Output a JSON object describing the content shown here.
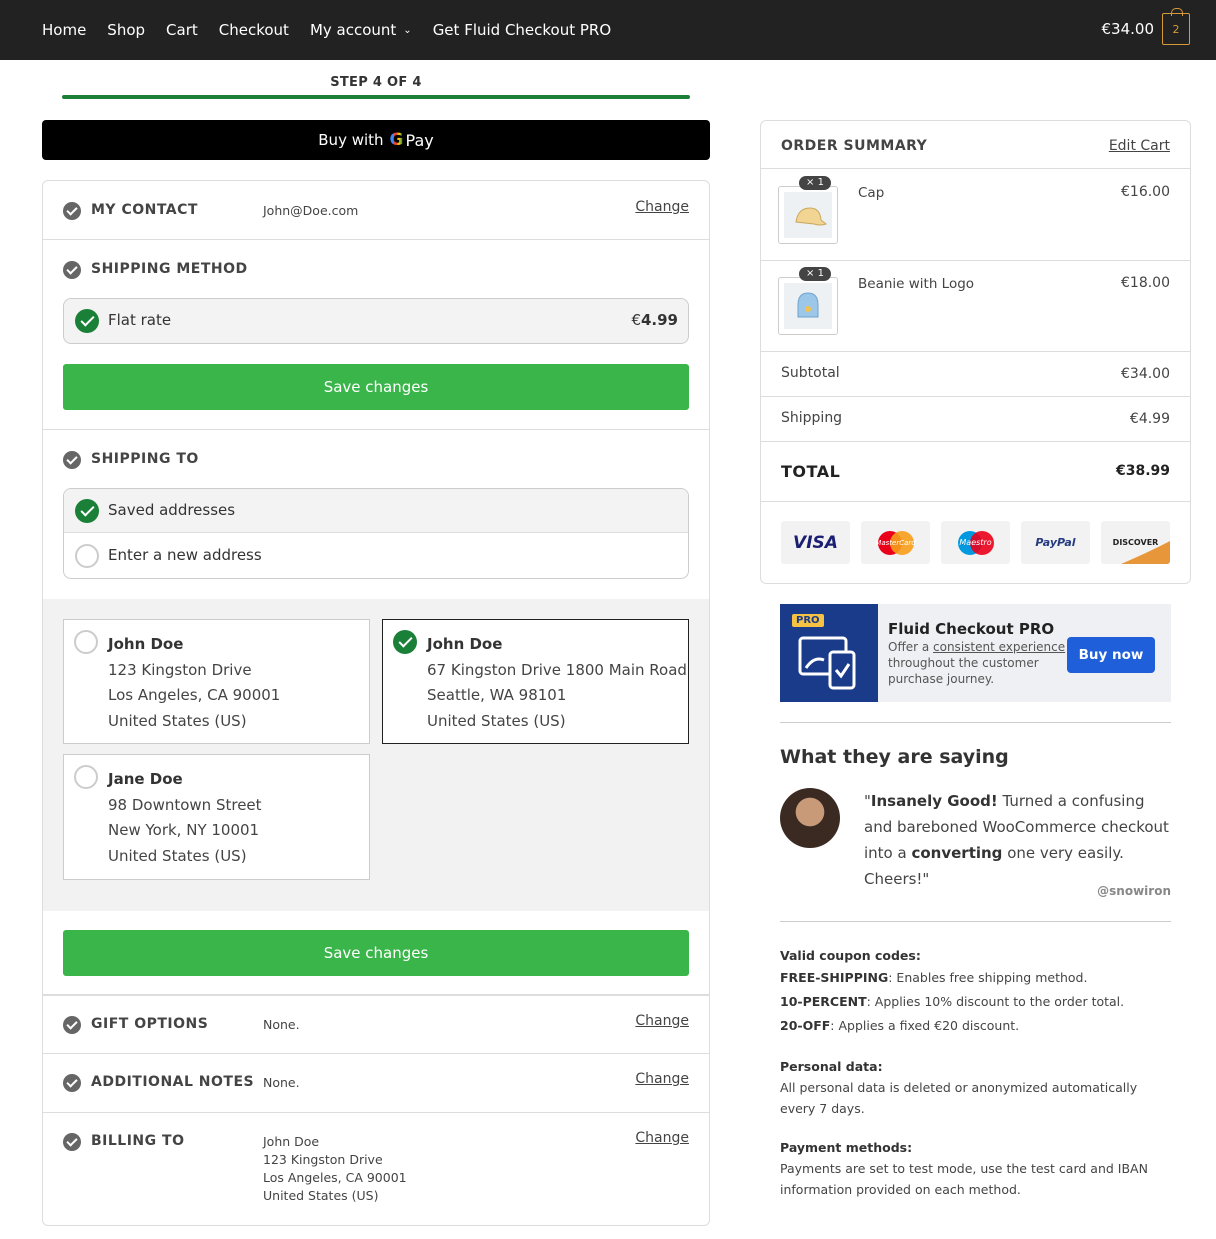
{
  "nav": {
    "items": [
      "Home",
      "Shop",
      "Cart",
      "Checkout",
      "My account",
      "Get Fluid Checkout PRO"
    ],
    "cart_total": "€34.00",
    "cart_count": "2"
  },
  "progress": {
    "label": "STEP 4 OF 4",
    "fraction": 1.0
  },
  "gpay": {
    "prefix": "Buy with",
    "g": "G",
    "pay": "Pay"
  },
  "contact": {
    "title": "MY CONTACT",
    "value": "John@Doe.com",
    "change": "Change"
  },
  "shipping_method": {
    "title": "SHIPPING METHOD",
    "option_label": "Flat rate",
    "option_price_symbol": "€",
    "option_price": "4.99",
    "save": "Save changes"
  },
  "shipping_to": {
    "title": "SHIPPING TO",
    "options": [
      "Saved addresses",
      "Enter a new address"
    ],
    "addresses": [
      {
        "name": "John Doe",
        "line1": "123 Kingston Drive",
        "line2": "Los Angeles, CA 90001",
        "country": "United States (US)"
      },
      {
        "name": "John Doe",
        "line1": "67 Kingston Drive 1800 Main Road",
        "line2": "Seattle, WA 98101",
        "country": "United States (US)"
      },
      {
        "name": "Jane Doe",
        "line1": "98 Downtown Street",
        "line2": "New York, NY 10001",
        "country": "United States (US)"
      }
    ],
    "save": "Save changes"
  },
  "gift": {
    "title": "GIFT OPTIONS",
    "value": "None.",
    "change": "Change"
  },
  "notes": {
    "title": "ADDITIONAL NOTES",
    "value": "None.",
    "change": "Change"
  },
  "billing": {
    "title": "BILLING TO",
    "lines": [
      "John Doe",
      "123 Kingston Drive",
      "Los Angeles, CA 90001",
      "United States (US)"
    ],
    "change": "Change"
  },
  "order_summary": {
    "title": "ORDER SUMMARY",
    "edit": "Edit Cart",
    "items": [
      {
        "qty": "× 1",
        "name": "Cap",
        "price": "€16.00"
      },
      {
        "qty": "× 1",
        "name": "Beanie with Logo",
        "price": "€18.00"
      }
    ],
    "subtotal_label": "Subtotal",
    "subtotal": "€34.00",
    "shipping_label": "Shipping",
    "shipping": "€4.99",
    "total_label": "TOTAL",
    "total": "€38.99",
    "payment_icons": [
      "VISA",
      "MasterCard",
      "Maestro",
      "PayPal",
      "DISCOVER"
    ]
  },
  "pro": {
    "tag": "PRO",
    "title": "Fluid Checkout PRO",
    "desc_pre": "Offer a ",
    "desc_link": "consistent experience",
    "desc_post": " throughout the customer purchase journey.",
    "button": "Buy now"
  },
  "testimonial": {
    "title": "What they are saying",
    "q1": "\"",
    "q_bold1": "Insanely Good!",
    "q2": " Turned a confusing and bareboned WooCommerce checkout into a ",
    "q_bold2": "converting",
    "q3": " one very easily. Cheers!\"",
    "handle": "@snowiron"
  },
  "info": {
    "coupons_title": "Valid coupon codes:",
    "coupons": [
      {
        "code": "FREE-SHIPPING",
        "desc": ": Enables free shipping method."
      },
      {
        "code": "10-PERCENT",
        "desc": ": Applies 10% discount to the order total."
      },
      {
        "code": "20-OFF",
        "desc": ": Applies a fixed €20 discount."
      }
    ],
    "personal_title": "Personal data:",
    "personal_text": "All personal data is deleted or anonymized automatically every 7 days.",
    "payment_title": "Payment methods:",
    "payment_text": "Payments are set to test mode, use the test card and IBAN information provided on each method."
  },
  "colors": {
    "accent_green": "#3ab54a",
    "check_green": "#1a7f37",
    "topbar": "#222222",
    "cart_orange": "#d79a39",
    "pro_blue": "#1f5fd9"
  }
}
